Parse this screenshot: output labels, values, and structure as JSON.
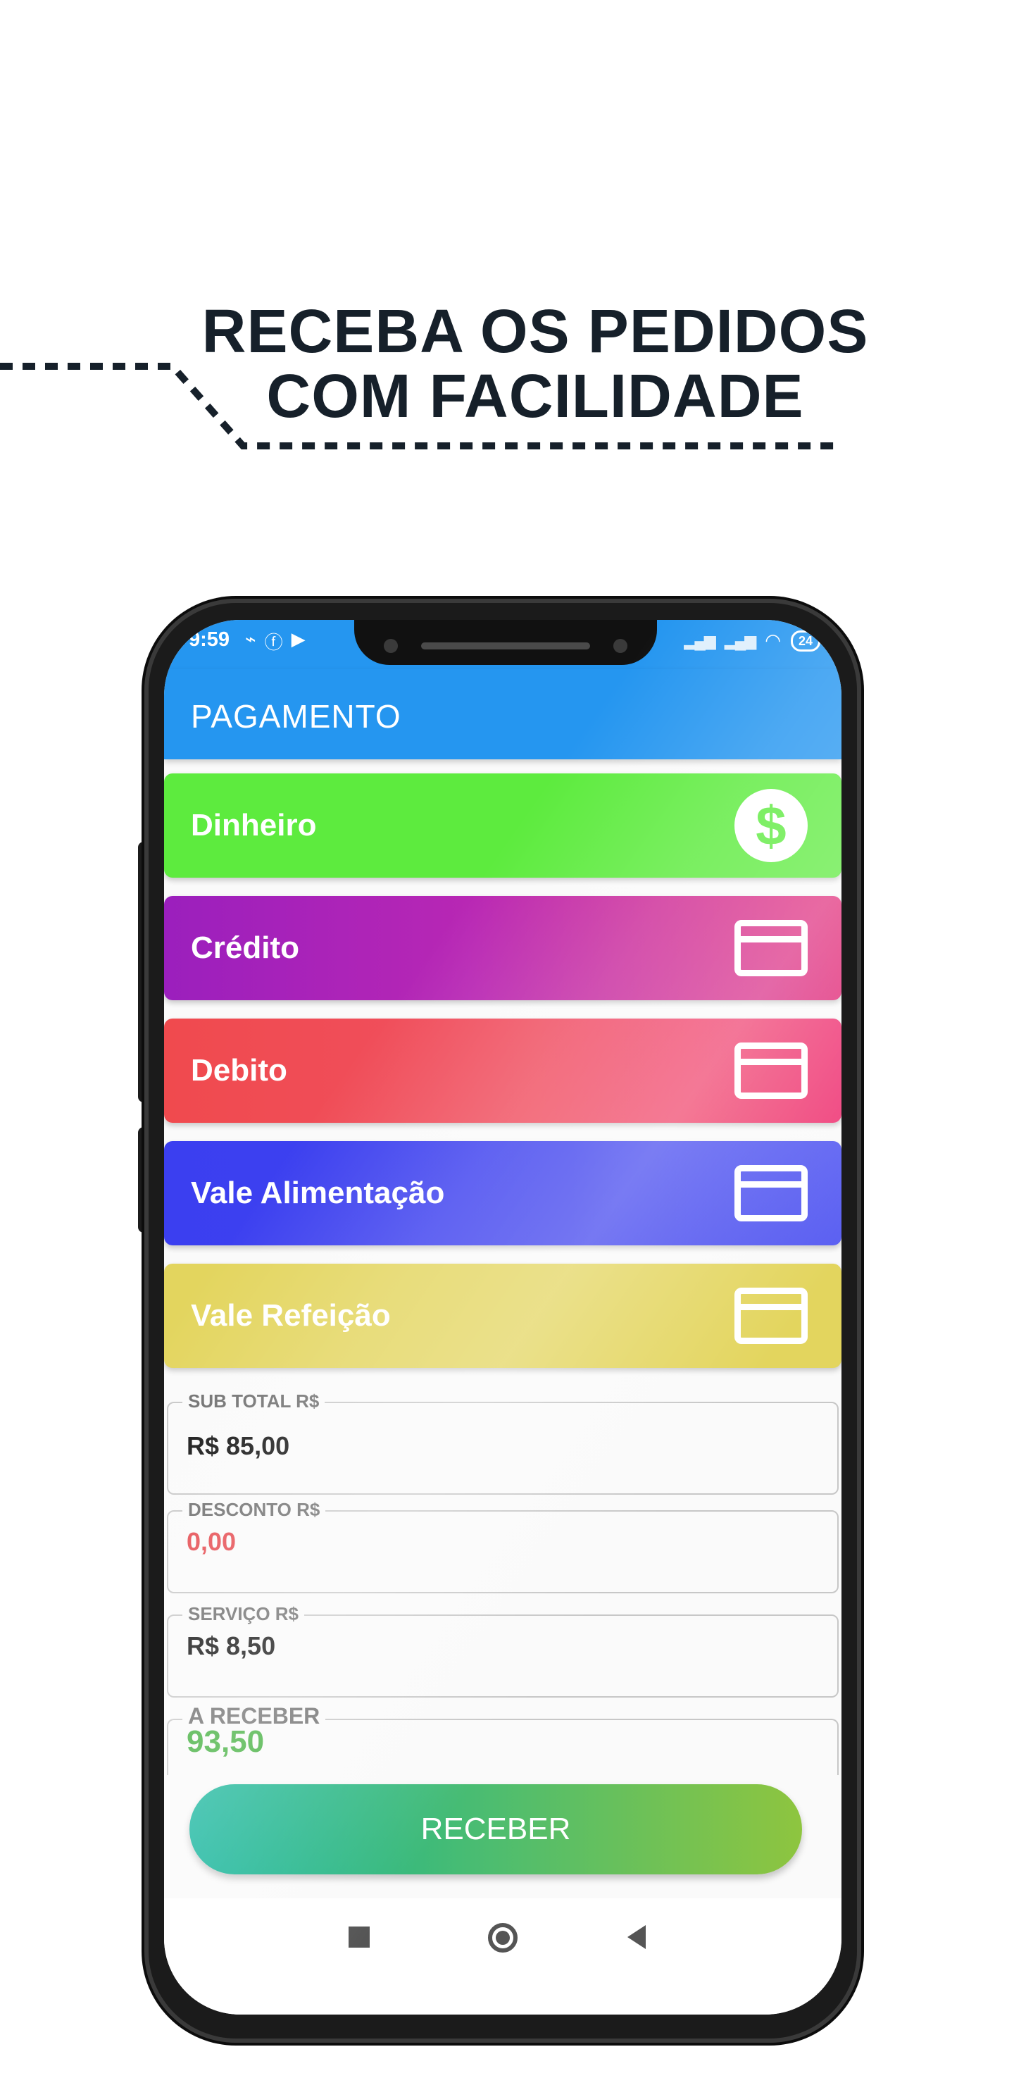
{
  "headline": {
    "line1": "RECEBA OS PEDIDOS",
    "line2": "COM FACILIDADE"
  },
  "status_bar": {
    "time": "9:59",
    "battery": "24"
  },
  "appbar": {
    "title": "PAGAMENTO"
  },
  "payment_methods": [
    {
      "label": "Dinheiro",
      "icon": "dollar-icon",
      "color": "#5deb3e"
    },
    {
      "label": "Crédito",
      "icon": "card-icon",
      "color": "#b827b4"
    },
    {
      "label": "Debito",
      "icon": "card-icon",
      "color": "#f04a4e"
    },
    {
      "label": "Vale Alimentação",
      "icon": "card-icon",
      "color": "#3b3ff0"
    },
    {
      "label": "Vale Refeição",
      "icon": "card-icon",
      "color": "#e3d55e"
    }
  ],
  "fields": {
    "subtotal": {
      "label": "SUB TOTAL R$",
      "value": "R$ 85,00"
    },
    "desconto": {
      "label": "DESCONTO R$",
      "value": "0,00"
    },
    "servico": {
      "label": "SERVIÇO R$",
      "value": "R$ 8,50"
    },
    "a_receber": {
      "label": "A RECEBER",
      "value": "93,50"
    }
  },
  "receber_button": {
    "label": "RECEBER"
  },
  "colors": {
    "appbar": "#2596f0",
    "desconto_value": "#e5484d",
    "a_receber_value": "#3fae3a"
  }
}
